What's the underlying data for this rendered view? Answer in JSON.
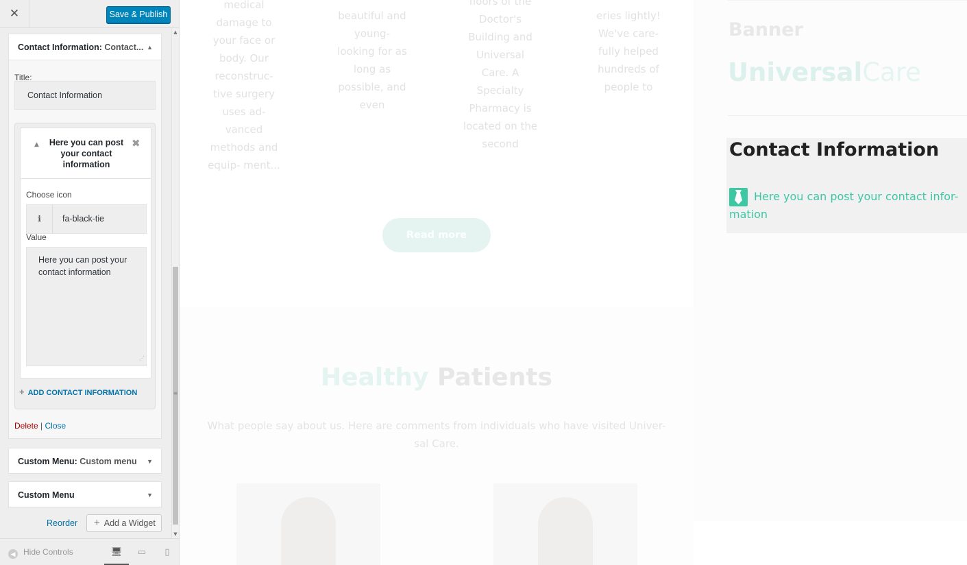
{
  "customizer": {
    "close_icon_glyph": "✕",
    "save_label": "Save & Publish",
    "scroll_up_glyph": "▲",
    "scroll_down_glyph": "▼",
    "scroll_grip_glyph": "≡",
    "contact_widget": {
      "head_title": "Contact Information:",
      "head_sub": " Contact...",
      "arrow": "▲",
      "title_label": "Title:",
      "title_value": "Contact Information",
      "item": {
        "collapse_glyph": "▲",
        "title": "Here you can post your contact information",
        "remove_glyph": "✖",
        "choose_icon_label": "Choose icon",
        "picker_glyph": "ℹ",
        "icon_value": "fa-black-tie",
        "value_label": "Value",
        "value_text": "Here you can post your contact information",
        "resize_glyph": "⋰"
      },
      "add_item_plus": "+",
      "add_item_label": "ADD CONTACT INFORMATION",
      "delete_label": "Delete",
      "separator": " | ",
      "close_label": "Close"
    },
    "custom_menu_1": {
      "title": "Custom Menu:",
      "sub": " Custom menu",
      "arrow": "▼"
    },
    "custom_menu_2": {
      "title": "Custom Menu",
      "arrow": "▼"
    },
    "reorder_label": "Reorder",
    "add_widget_plus": "+",
    "add_widget_label": "Add a Widget",
    "footer": {
      "hide_glyph": "◀",
      "hide_controls_label": "Hide Controls",
      "desktop_glyph": "🖥",
      "tablet_glyph": "▭",
      "mobile_glyph": "▯"
    }
  },
  "preview": {
    "columns": [
      "medical damage to your face or body. Our reconstruc- tive surgery uses ad- vanced methods and equip- ment...",
      "beautiful and young- looking for as long as possible, and even",
      "floors of the Doctor's Building and Universal Care. A Specialty Pharmacy is located on the second",
      "eries lightly! We've care- fully helped hundreds of people to"
    ],
    "read_more_label": "Read more",
    "hp_title_a": "Healthy",
    "hp_title_b": " Patients",
    "hp_sub": "What people say about us. Here are comments from individuals who have visited Univer- sal Care.",
    "sidebar": {
      "banner_title": "Banner",
      "logo_a": "Universal",
      "logo_b": "Care",
      "contact_title": "Contact Information",
      "contact_text": "Here you can post your contact infor- mation",
      "contact_icon": "black-tie-icon",
      "accent_color": "#3dc7a3"
    }
  }
}
